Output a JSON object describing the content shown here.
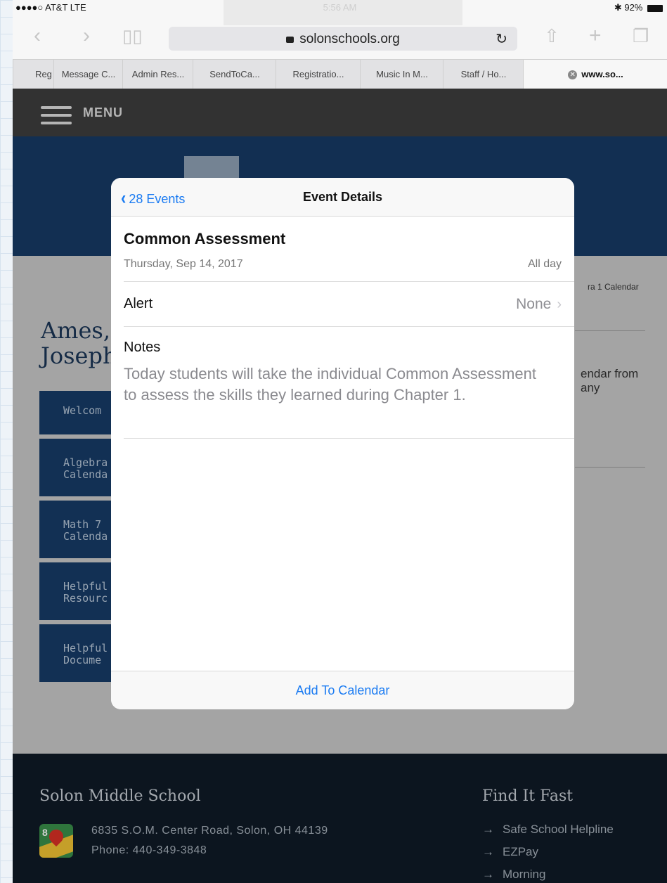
{
  "status": {
    "carrier": "●●●●○ AT&T  LTE",
    "time": "5:56 AM",
    "battery": "92%"
  },
  "browser": {
    "url": "solonschools.org",
    "tabs": [
      "Reg",
      "Message C...",
      "Admin Res...",
      "SendToCa...",
      "Registratio...",
      "Music In M...",
      "Staff / Ho...",
      "www.so..."
    ]
  },
  "site": {
    "menu_label": "MENU",
    "page_title": "Ames,\nJoseph",
    "side_buttons": [
      "Welcom",
      "Algebra\nCalenda",
      "Math 7\nCalenda",
      "Helpful\nResourc",
      "Helpful\nDocume"
    ],
    "right_fragment_1": "ra 1 Calendar",
    "right_fragment_2": "endar from\nany",
    "footer": {
      "school": "Solon Middle School",
      "address": "6835 S.O.M. Center Road, Solon, OH 44139",
      "phone": "Phone: 440-349-3848",
      "find_it_fast": "Find It Fast",
      "links": [
        "Safe School Helpline",
        "EZPay",
        "Morning"
      ]
    }
  },
  "modal": {
    "back_label": "28 Events",
    "title": "Event Details",
    "event_title": "Common Assessment",
    "event_date": "Thursday, Sep 14, 2017",
    "all_day": "All day",
    "alert_label": "Alert",
    "alert_value": "None",
    "notes_label": "Notes",
    "notes_body": "Today students will take the individual Common Assessment to assess the skills they learned during Chapter 1.",
    "add_button": "Add To Calendar"
  },
  "colors": {
    "accent": "#1a7bf2",
    "site_navy": "#173a64"
  }
}
